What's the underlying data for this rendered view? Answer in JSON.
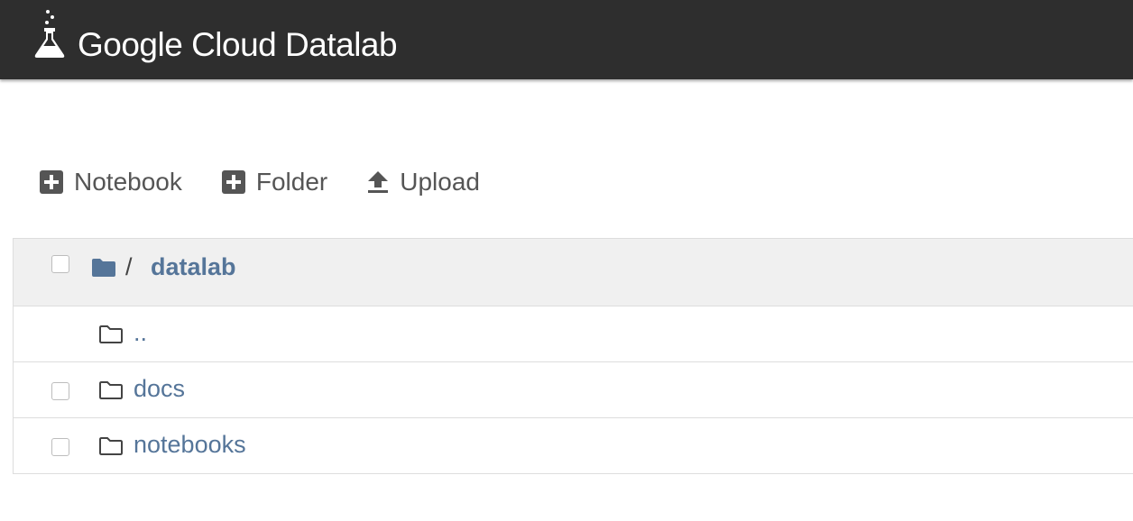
{
  "header": {
    "brand_text": "Google Cloud Datalab",
    "logo_icon": "flask-icon",
    "background_color": "#2e2e2e"
  },
  "toolbar": {
    "notebook_label": "Notebook",
    "folder_label": "Folder",
    "upload_label": "Upload",
    "icons": [
      "plus-square-icon",
      "plus-square-icon",
      "upload-icon"
    ]
  },
  "breadcrumb": {
    "separator": "/",
    "current": "datalab"
  },
  "files": {
    "parent": "..",
    "items": [
      {
        "name": "docs",
        "type": "folder"
      },
      {
        "name": "notebooks",
        "type": "folder"
      }
    ]
  },
  "colors": {
    "link": "#557599",
    "toolbar_text": "#555555",
    "header_row_bg": "#f0f0f0"
  }
}
